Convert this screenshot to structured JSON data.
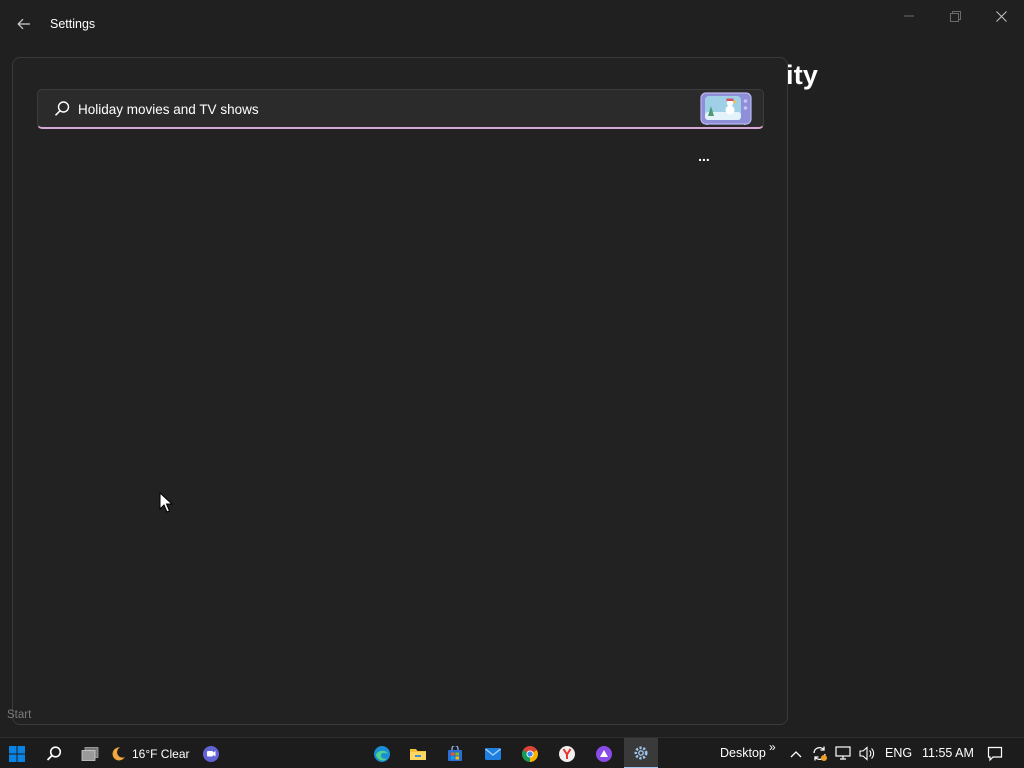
{
  "window": {
    "title": "Settings",
    "behind_heading": "ity"
  },
  "search": {
    "query": "Holiday movies and TV shows",
    "more_label": "...",
    "accent_color": "#d7a7d6"
  },
  "tooltip": {
    "start": "Start"
  },
  "taskbar": {
    "weather": "16°F Clear",
    "desktop_label": "Desktop",
    "overflow_chevron": "»",
    "language": "ENG",
    "time": "11:55 AM",
    "apps": [
      "start-icon",
      "search-icon",
      "task-view-icon",
      "weather-moon-icon",
      "teams-chat-icon",
      "edge-icon",
      "file-explorer-icon",
      "store-icon",
      "mail-icon",
      "chrome-icon",
      "yandex-icon",
      "purple-app-icon",
      "settings-gear-icon"
    ],
    "tray": [
      "chevron-up-icon",
      "sync-icon",
      "network-icon",
      "volume-icon",
      "notification-icon"
    ]
  }
}
